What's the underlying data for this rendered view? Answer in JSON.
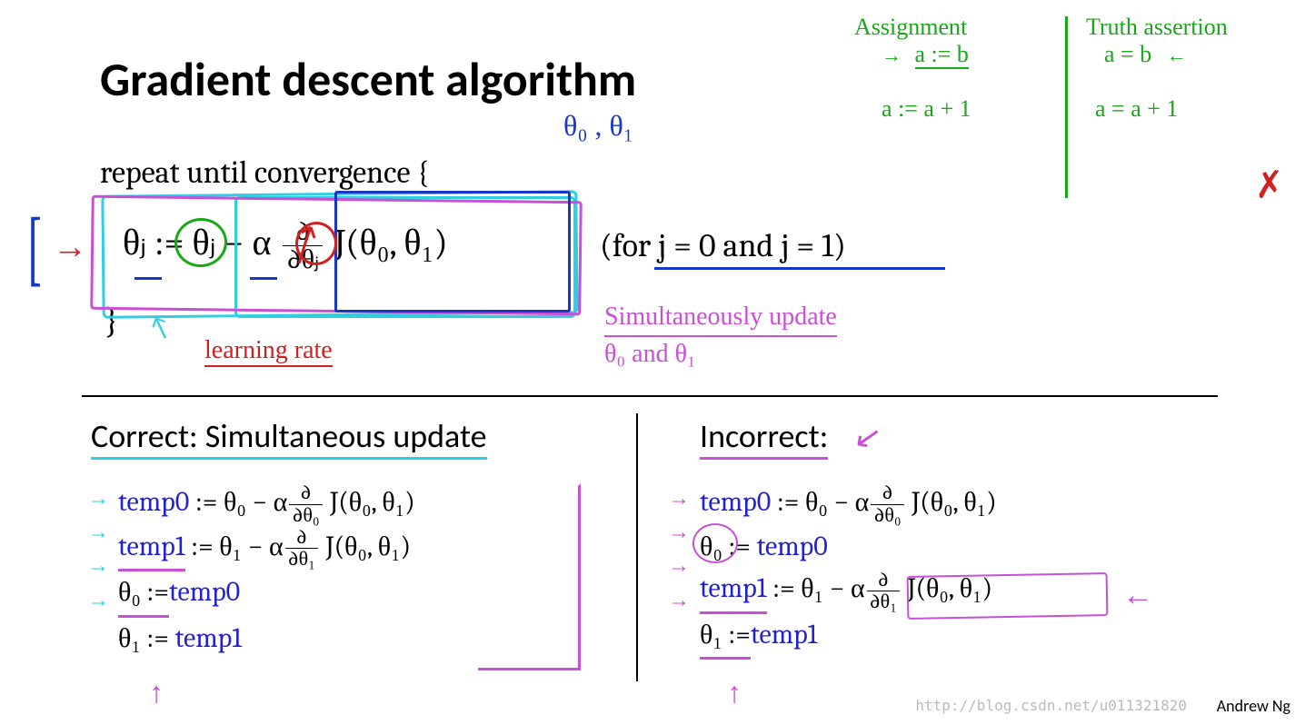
{
  "title": "Gradient descent algorithm",
  "repeat_text": "repeat until convergence {",
  "close_brace": "}",
  "update_rule": {
    "lhs": "θⱼ",
    "assign": ":=",
    "rhs_term1": "θⱼ",
    "minus": " − ",
    "alpha": "α",
    "frac_num": "∂",
    "frac_den": "∂θⱼ",
    "J": "J(θ₀, θ₁)"
  },
  "for_text": "(for j = 0 and j = 1)",
  "theta_note": "θ₀ , θ₁",
  "learning_rate_label": "learning rate",
  "sim_update_line1": "Simultaneously   update",
  "sim_update_line2": "θ₀  and  θ₁",
  "correct_heading": "Correct: Simultaneous update",
  "incorrect_heading": "Incorrect:",
  "eq_correct": [
    {
      "lhs": "temp0",
      "rhs": " := θ₀ − α",
      "num": "∂",
      "den": "∂θ₀",
      "tail": " J(θ₀, θ₁)"
    },
    {
      "lhs": "temp1",
      "rhs": " := θ₁ − α",
      "num": "∂",
      "den": "∂θ₁",
      "tail": " J(θ₀, θ₁)"
    },
    {
      "text": "θ₀ := ",
      "temp": "temp0"
    },
    {
      "text": "θ₁ := ",
      "temp": "temp1"
    }
  ],
  "eq_incorrect": [
    {
      "lhs": "temp0",
      "rhs": " := θ₀ − α",
      "num": "∂",
      "den": "∂θ₀",
      "tail": " J(θ₀, θ₁)"
    },
    {
      "text": "θ₀ := ",
      "temp": "temp0"
    },
    {
      "lhs": "temp1",
      "rhs": " := θ₁ − α",
      "num": "∂",
      "den": "∂θ₁",
      "tail": " J(θ₀, θ₁)"
    },
    {
      "text": "θ₁ := ",
      "temp": "temp1"
    }
  ],
  "notes": {
    "assignment_head": "Assignment",
    "assignment_l1": "a := b",
    "assignment_l2": "a := a + 1",
    "truth_head": "Truth assertion",
    "truth_l1": "a = b",
    "truth_l2": "a = a + 1"
  },
  "credit": "Andrew Ng",
  "watermark": "http://blog.csdn.net/u011321820",
  "arrows": {
    "right": "→",
    "left": "←",
    "up": "↑",
    "down_left": "↙"
  }
}
